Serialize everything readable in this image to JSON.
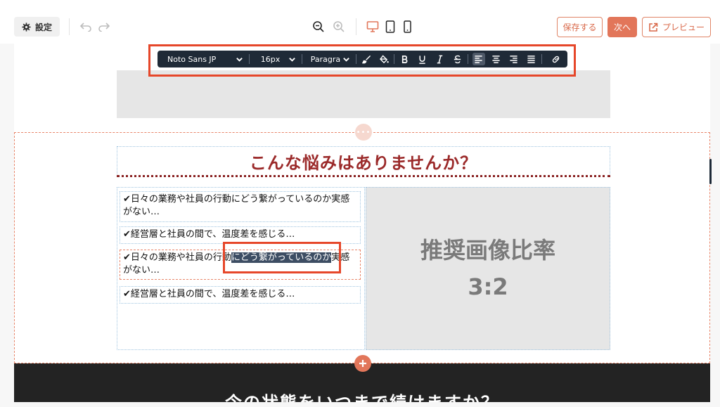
{
  "topbar": {
    "settings_label": "設定",
    "save_label": "保存する",
    "next_label": "次へ",
    "preview_label": "プレビュー"
  },
  "toolbar": {
    "font_family": "Noto Sans JP",
    "font_size": "16px",
    "block_format": "Paragra"
  },
  "section": {
    "heading": "こんな悩みはありませんか？",
    "items": [
      {
        "text": "✔日々の業務や社員の行動にどう繋がっているのか実感がない…"
      },
      {
        "text": "✔経営層と社員の間で、温度差を感じる…"
      },
      {
        "before": "✔日々の業務や社員の行動",
        "selected": "にどう繋がっているのか",
        "after": "実感がない…"
      },
      {
        "text": "✔経営層と社員の間で、温度差を感じる…"
      }
    ],
    "image_placeholder_line1": "推奨画像比率",
    "image_placeholder_line2": "3:2"
  },
  "next_section": {
    "heading": "今の状態をいつまで続けますか？"
  },
  "colors": {
    "accent": "#e2765a",
    "toolbar_bg": "#1f2a37",
    "heading": "#9b2a2a",
    "highlight_box": "#e6472a"
  }
}
